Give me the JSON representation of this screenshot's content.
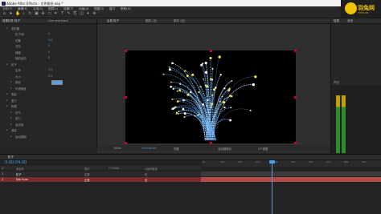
{
  "window": {
    "title": "Adobe After Effects - 文件路径.aep *"
  },
  "menu": [
    "文件(F)",
    "编辑(E)",
    "合成(C)",
    "图层(L)",
    "效果(T)",
    "动画(A)",
    "视图(V)",
    "窗口",
    "帮助(H)"
  ],
  "logo": {
    "text": "羽兔网",
    "sub": "YUTU.CN"
  },
  "effects_panel": {
    "tabs": [
      "效果控件 粒子",
      "Line and track"
    ],
    "rows": [
      {
        "label": "发射器",
        "value": "",
        "level": 0
      },
      {
        "label": "粒子/秒",
        "value": "0",
        "level": 1
      },
      {
        "label": "位置",
        "value": "0,0",
        "level": 1
      },
      {
        "label": "方向",
        "value": "0",
        "level": 1
      },
      {
        "label": "速度",
        "value": "0",
        "level": 1
      },
      {
        "label": "随机运动",
        "value": "0",
        "level": 1
      },
      {
        "label": "粒子",
        "value": "",
        "level": 0
      },
      {
        "label": "生命",
        "value": "2.0",
        "level": 1
      },
      {
        "label": "大小",
        "value": "2.5",
        "level": 1
      },
      {
        "label": "颜色",
        "value": "",
        "level": 1
      },
      {
        "label": "不透明度",
        "value": "",
        "level": 1
      },
      {
        "label": "阴影",
        "value": "",
        "level": 0
      },
      {
        "label": "重力",
        "value": "",
        "level": 0
      },
      {
        "label": "物理",
        "value": "",
        "level": 0
      },
      {
        "label": "空气",
        "value": "",
        "level": 1
      },
      {
        "label": "风力",
        "value": "",
        "level": 1
      },
      {
        "label": "湍流场",
        "value": "",
        "level": 1
      },
      {
        "label": "渲染",
        "value": "",
        "level": 0
      },
      {
        "label": "运动模糊",
        "value": "",
        "level": 1
      }
    ],
    "color_swatch": "#5d9ce6"
  },
  "composition": {
    "tabs": [
      "合成 粒子",
      "图层 (无)",
      "素材 (无)"
    ],
    "zoom": "100%",
    "timecode": "0:00:00:00",
    "resolution": "完整",
    "camera": "活动摄像机",
    "views": "1个视图"
  },
  "right_panel": {
    "tabs": [
      "信息",
      "音频"
    ],
    "labels": [
      "预览",
      "效果和预设"
    ]
  },
  "timeline": {
    "tab": "粒子",
    "timecode": "0:00:04:00",
    "headers": [
      "#",
      "源名称",
      "模式",
      "T TrkMat",
      "父级和链接"
    ],
    "layers": [
      {
        "num": "1",
        "name": "粒子",
        "mode": "正常",
        "parent": "无"
      },
      {
        "num": "2",
        "name": "Dot Form",
        "mode": "正常",
        "parent": "无"
      }
    ],
    "ruler": [
      "0s",
      "01s",
      "02s",
      "03s",
      "04s",
      "05s",
      "06s",
      "07s",
      "08s",
      "09s"
    ]
  }
}
